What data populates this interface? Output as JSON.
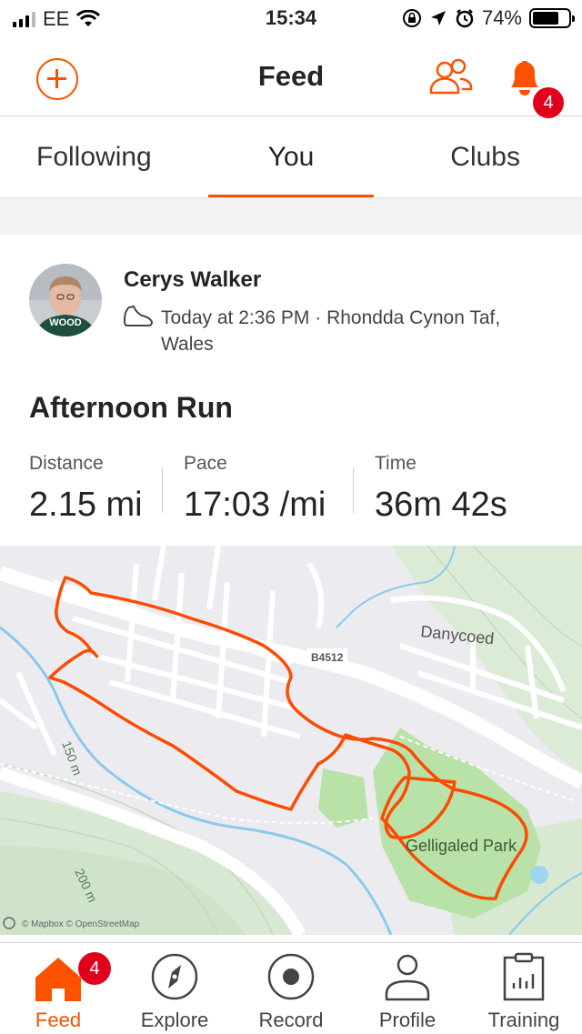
{
  "status_bar": {
    "carrier": "EE",
    "time": "15:34",
    "battery": "74%",
    "battery_level": 0.74
  },
  "header": {
    "title": "Feed",
    "notification_count": "4"
  },
  "tabs": [
    {
      "label": "Following"
    },
    {
      "label": "You"
    },
    {
      "label": "Clubs"
    }
  ],
  "active_tab": "You",
  "activity": {
    "athlete_name": "Cerys Walker",
    "meta": "Today at 2:36 PM · Rhondda Cynon Taf, Wales",
    "avatar_text": "WOOD",
    "title": "Afternoon Run",
    "stats": [
      {
        "label": "Distance",
        "value": "2.15 mi"
      },
      {
        "label": "Pace",
        "value": "17:03 /mi"
      },
      {
        "label": "Time",
        "value": "36m 42s"
      }
    ]
  },
  "map": {
    "labels": {
      "danycoed": "Danycoed",
      "road": "B4512",
      "park": "Gelligaled Park",
      "contour_150": "150 m",
      "contour_200": "200 m",
      "attribution": "© Mapbox © OpenStreetMap"
    },
    "colors": {
      "route": "#fc4c02",
      "park": "#b8e3a6",
      "water": "#7cc4e8",
      "land": "#ebebef",
      "terrain": "#d6e8d2"
    }
  },
  "bottom_nav": {
    "items": [
      {
        "label": "Feed",
        "icon": "home-icon",
        "active": true
      },
      {
        "label": "Explore",
        "icon": "compass-icon"
      },
      {
        "label": "Record",
        "icon": "record-icon"
      },
      {
        "label": "Profile",
        "icon": "profile-icon"
      },
      {
        "label": "Training",
        "icon": "training-icon"
      }
    ],
    "feed_badge": "4"
  },
  "accent_color": "#fc5200"
}
